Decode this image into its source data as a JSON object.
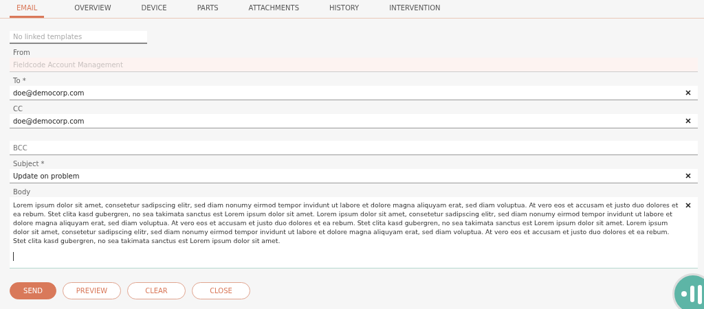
{
  "tabs": [
    {
      "label": "EMAIL",
      "selected": true
    },
    {
      "label": "OVERVIEW",
      "selected": false
    },
    {
      "label": "DEVICE",
      "selected": false
    },
    {
      "label": "PARTS",
      "selected": false
    },
    {
      "label": "ATTACHMENTS",
      "selected": false
    },
    {
      "label": "HISTORY",
      "selected": false
    },
    {
      "label": "INTERVENTION",
      "selected": false
    }
  ],
  "template": {
    "placeholder": "No linked templates"
  },
  "fields": [
    {
      "label": "From",
      "value": "Fieldcode Account Management",
      "disabled": true,
      "clearable": false
    },
    {
      "label": "To *",
      "value": "doe@democorp.com",
      "disabled": false,
      "clearable": true
    },
    {
      "label": "CC",
      "value": "doe@democorp.com",
      "disabled": false,
      "clearable": true
    },
    {
      "placeholder": "BCC",
      "disabled": false,
      "clearable": false
    },
    {
      "label": "Subject *",
      "value": "Update on problem",
      "disabled": false,
      "clearable": true
    }
  ],
  "body": {
    "label": "Body",
    "value": "Lorem ipsum dolor sit amet, consetetur sadipscing elitr, sed diam nonumy eirmod tempor invidunt ut labore et dolore magna aliquyam erat, sed diam voluptua. At vero eos et accusam et justo duo dolores et ea rebum. Stet clita kasd gubergren, no sea takimata sanctus est Lorem ipsum dolor sit amet. Lorem ipsum dolor sit amet, consetetur sadipscing elitr, sed diam nonumy eirmod tempor invidunt ut labore et dolore magna aliquyam erat, sed diam voluptua. At vero eos et accusam et justo duo dolores et ea rebum. Stet clita kasd gubergren, no sea takimata sanctus est Lorem ipsum dolor sit amet. Lorem ipsum dolor sit amet, consetetur sadipscing elitr, sed diam nonumy eirmod tempor invidunt ut labore et dolore magna aliquyam erat, sed diam voluptua. At vero eos et accusam et justo duo dolores et ea rebum. Stet clita kasd gubergren, no sea takimata sanctus est Lorem ipsum dolor sit amet.",
    "clearable": true
  },
  "buttons": [
    {
      "label": "SEND",
      "kind": "primary"
    },
    {
      "label": "PREVIEW",
      "kind": "outline"
    },
    {
      "label": "CLEAR",
      "kind": "outline"
    },
    {
      "label": "CLOSE",
      "kind": "outline"
    }
  ]
}
